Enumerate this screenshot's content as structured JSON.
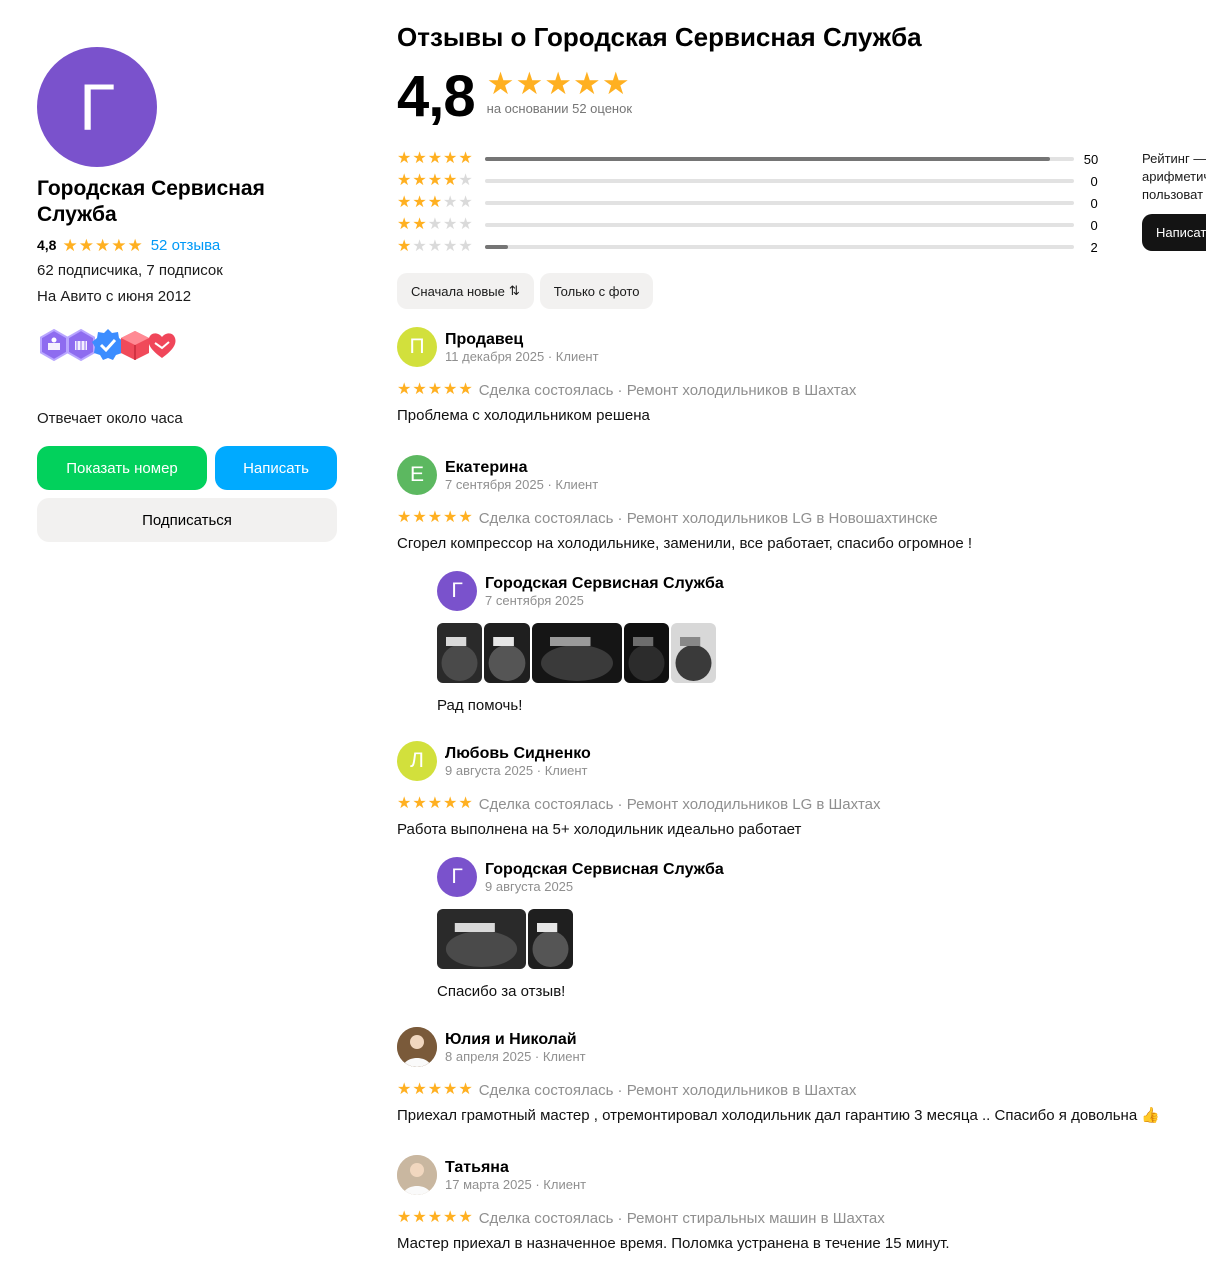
{
  "seller": {
    "avatar_letter": "Г",
    "avatar_color": "#7a52cc",
    "name": "Городская Сервисная Служба",
    "rating": "4,8",
    "reviews_link": "52 отзыва",
    "followers": "62 подписчика, 7 подписок",
    "since": "На Авито с июня 2012",
    "badges": [
      "star-badge-icon",
      "cart-badge-icon",
      "verified-badge-icon",
      "box-badge-icon",
      "handshake-badge-icon"
    ],
    "response_time": "Отвечает около часа",
    "show_phone_label": "Показать номер",
    "write_label": "Написать",
    "subscribe_label": "Подписаться"
  },
  "reviews_page": {
    "title": "Отзывы о Городская Сервисная Служба",
    "big_rating": "4,8",
    "based_on": "на основании 52 оценок",
    "distribution": [
      {
        "stars": 5,
        "count": "50",
        "fraction": 0.96
      },
      {
        "stars": 4,
        "count": "0",
        "fraction": 0
      },
      {
        "stars": 3,
        "count": "0",
        "fraction": 0
      },
      {
        "stars": 2,
        "count": "0",
        "fraction": 0
      },
      {
        "stars": 1,
        "count": "2",
        "fraction": 0.04
      }
    ],
    "rating_note_lines": [
      "Рейтинг —",
      "арифметич",
      "пользоват"
    ],
    "write_review_label": "Написат",
    "filters": {
      "sort_label": "Сначала новые",
      "photo_only_label": "Только с фото"
    }
  },
  "colors": {
    "star": "#ffb021",
    "green_button": "#02d15c",
    "blue_button": "#00aaff",
    "link": "#0099f7"
  },
  "reviews": [
    {
      "avatar_letter": "П",
      "avatar_color": "#d2e03c",
      "name": "Продавец",
      "date": "11 декабря 2025 · Клиент",
      "stars": 5,
      "deal": "Сделка состоялась · Ремонт холодильников в Шахтах",
      "text": "Проблема с холодильником решена"
    },
    {
      "avatar_letter": "Е",
      "avatar_color": "#5cb860",
      "name": "Екатерина",
      "date": "7 сентября 2025 · Клиент",
      "stars": 5,
      "deal": "Сделка состоялась · Ремонт холодильников LG в Новошахтинске",
      "text": "Сгорел компрессор на холодильнике, заменили, все работает, спасибо огромное !",
      "reply": {
        "avatar_letter": "Г",
        "name": "Городская Сервисная Служба",
        "date": "7 сентября 2025",
        "photo_count": 5,
        "text": "Рад помочь!"
      }
    },
    {
      "avatar_letter": "Л",
      "avatar_color": "#d2e03c",
      "name": "Любовь Сидненко",
      "date": "9 августа 2025 · Клиент",
      "stars": 5,
      "deal": "Сделка состоялась · Ремонт холодильников LG в Шахтах",
      "text": "Работа выполнена на 5+ холодильник идеально работает",
      "reply": {
        "avatar_letter": "Г",
        "name": "Городская Сервисная Служба",
        "date": "9 августа 2025",
        "photo_count": 2,
        "text": "Спасибо за отзыв!"
      }
    },
    {
      "avatar_letter": "",
      "avatar_color": "#7a5a3a",
      "name": "Юлия и Николай",
      "date": "8 апреля 2025 · Клиент",
      "stars": 5,
      "deal": "Сделка состоялась · Ремонт холодильников в Шахтах",
      "text": "Приехал грамотный мастер , отремонтировал холодильник дал гарантию 3 месяца .. Спасибо я довольна 👍"
    },
    {
      "avatar_letter": "",
      "avatar_color": "#c9b7a0",
      "name": "Татьяна",
      "date": "17 марта 2025 · Клиент",
      "stars": 5,
      "deal": "Сделка состоялась · Ремонт стиральных машин в Шахтах",
      "text": "Мастер приехал в назначенное время. Поломка устранена в течение 15 минут."
    }
  ]
}
